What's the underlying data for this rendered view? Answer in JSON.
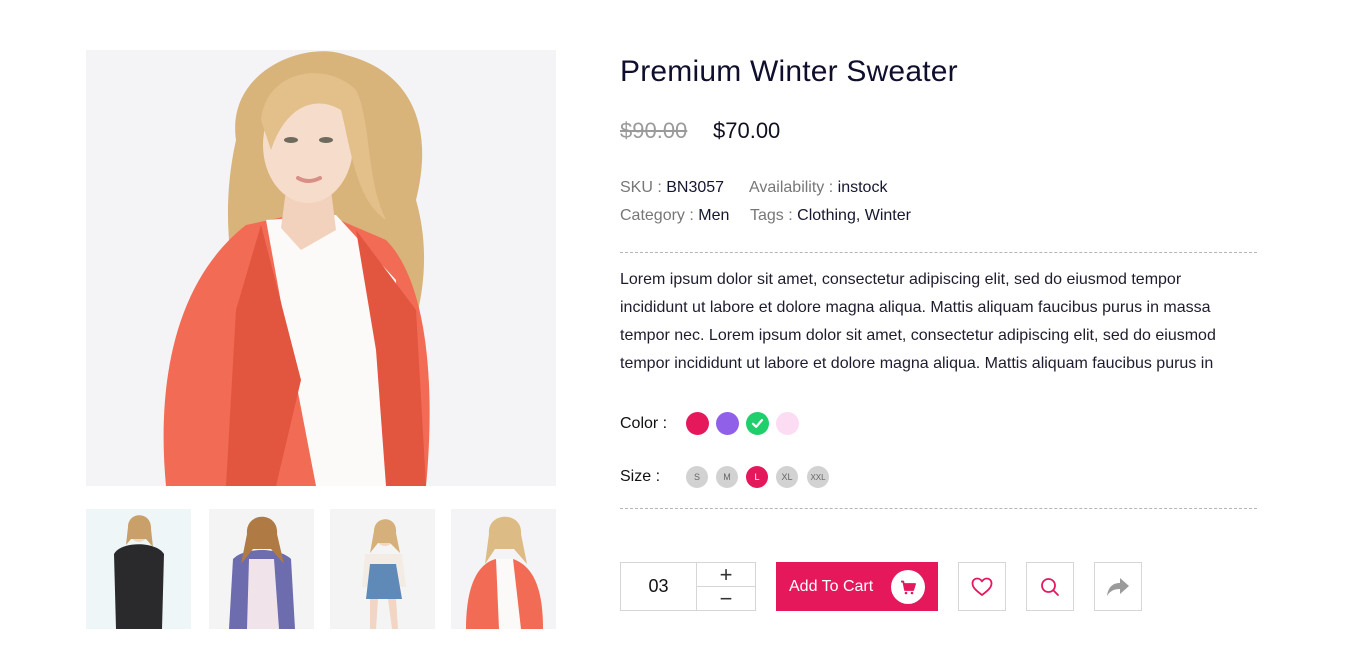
{
  "product": {
    "title": "Premium Winter Sweater",
    "old_price": "$90.00",
    "price": "$70.00",
    "sku_label": "SKU : ",
    "sku": "BN3057",
    "availability_label": "Availability : ",
    "availability": "instock",
    "category_label": "Category : ",
    "category": "Men",
    "tags_label": "Tags : ",
    "tags": "Clothing, Winter",
    "description": "Lorem ipsum dolor sit amet, consectetur adipiscing elit, sed do eiusmod tempor incididunt ut labore et dolore magna aliqua. Mattis aliquam faucibus purus in massa tempor nec. Lorem ipsum dolor sit amet, consectetur adipiscing elit, sed do eiusmod tempor incididunt ut labore et dolore magna aliqua. Mattis aliquam faucibus purus in"
  },
  "options": {
    "color_label": "Color :",
    "colors": [
      {
        "hex": "#e5185c",
        "selected": false
      },
      {
        "hex": "#9061e8",
        "selected": false
      },
      {
        "hex": "#1fcf6b",
        "selected": true
      },
      {
        "hex": "#fcdcf3",
        "selected": false
      }
    ],
    "size_label": "Size :",
    "sizes": [
      {
        "label": "S",
        "selected": false
      },
      {
        "label": "M",
        "selected": false
      },
      {
        "label": "L",
        "selected": true
      },
      {
        "label": "XL",
        "selected": false
      },
      {
        "label": "XXL",
        "selected": false
      }
    ]
  },
  "actions": {
    "quantity": "03",
    "plus": "+",
    "minus": "−",
    "add_to_cart": "Add To Cart",
    "icons": [
      "heart-icon",
      "search-icon",
      "share-icon",
      "cart-icon"
    ]
  },
  "theme": {
    "accent": "#e5185c",
    "title_color": "#0f0f2d",
    "muted": "#777777"
  }
}
